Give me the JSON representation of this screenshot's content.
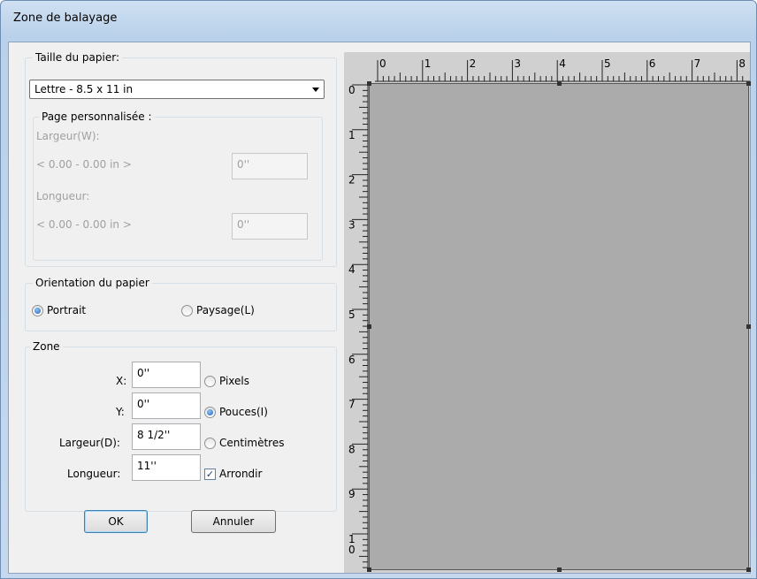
{
  "window": {
    "title": "Zone de balayage"
  },
  "paper_size": {
    "legend": "Taille du papier:",
    "selected": "Lettre - 8.5 x 11 in",
    "custom_page": {
      "legend": "Page personnalisée :",
      "width_label": "Largeur(W):",
      "width_range": "< 0.00 - 0.00 in >",
      "width_value": "0''",
      "length_label": "Longueur:",
      "length_range": "< 0.00 - 0.00 in >",
      "length_value": "0''"
    }
  },
  "orientation": {
    "legend": "Orientation du papier",
    "portrait_label": "Portrait",
    "landscape_label": "Paysage(L)",
    "selected": "Portrait"
  },
  "zone": {
    "legend": "Zone",
    "x_label": "X:",
    "x_value": "0''",
    "y_label": "Y:",
    "y_value": "0''",
    "width_label": "Largeur(D):",
    "width_value": "8 1/2''",
    "length_label": "Longueur:",
    "length_value": "11''",
    "unit_pixels": "Pixels",
    "unit_inches": "Pouces(I)",
    "unit_cm": "Centimètres",
    "selected_unit": "Pouces(I)",
    "round_label": "Arrondir",
    "round_checked": true
  },
  "buttons": {
    "ok": "OK",
    "cancel": "Annuler"
  },
  "preview": {
    "h_ruler_labels": [
      "0",
      "1",
      "2",
      "3",
      "4",
      "5",
      "6",
      "7",
      "8"
    ],
    "v_ruler_labels": [
      "0",
      "1",
      "2",
      "3",
      "4",
      "5",
      "6",
      "7",
      "8",
      "9",
      "1",
      "0"
    ]
  },
  "colors": {
    "preview_area": "#ababab",
    "ruler": "#d0d0d0"
  }
}
